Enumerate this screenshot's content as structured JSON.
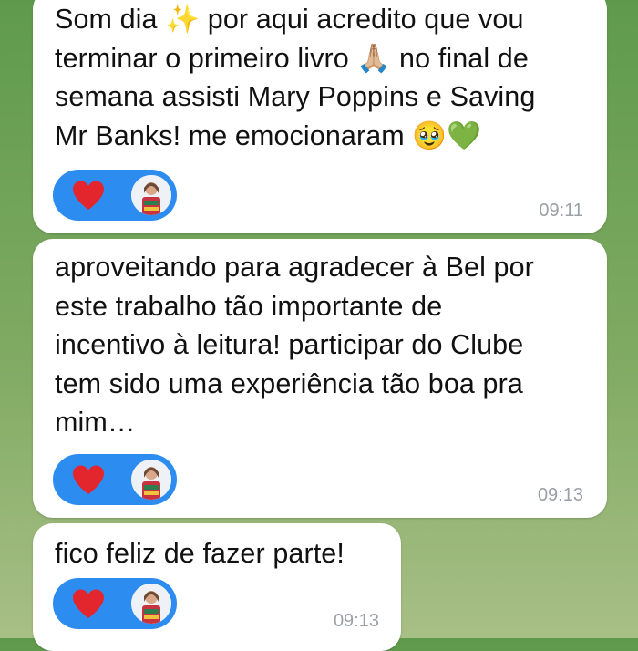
{
  "messages": [
    {
      "text": "Som dia ✨ por aqui acredito que vou\nterminar o primeiro livro 🙏🏼 no final de\nsemana assisti Mary Poppins e Saving\nMr Banks! me emocionaram 🥹💚",
      "time": "09:11",
      "reaction": "heart-icon"
    },
    {
      "text": "aproveitando para agradecer à Bel por\neste trabalho tão importante de\nincentivo à leitura! participar do Clube\ntem sido uma experiência tão boa pra\nmim…",
      "time": "09:13",
      "reaction": "heart-icon"
    },
    {
      "text": "fico feliz de fazer parte!",
      "time": "09:13",
      "reaction": "heart-icon"
    }
  ],
  "colors": {
    "reaction_pill": "#2c8cf0",
    "heart": "#e3262e",
    "bubble": "#ffffff",
    "timestamp": "#9aa0a6"
  }
}
